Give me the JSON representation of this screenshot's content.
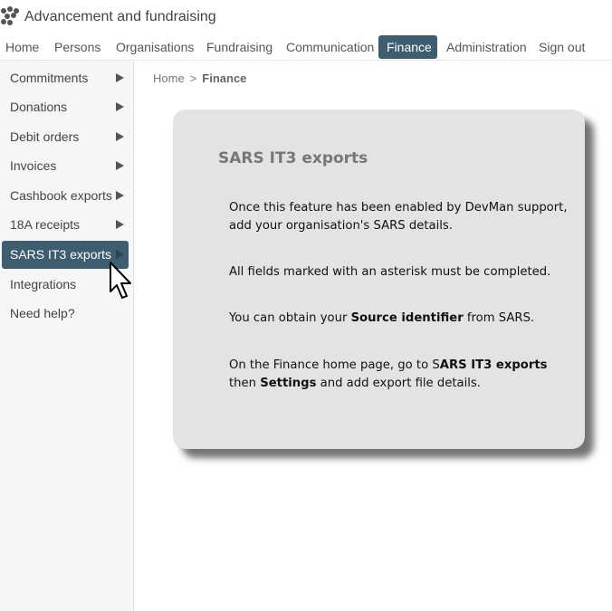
{
  "app": {
    "title": "Advancement and fundraising"
  },
  "topnav": {
    "items": [
      {
        "label": "Home"
      },
      {
        "label": "Persons"
      },
      {
        "label": "Organisations"
      },
      {
        "label": "Fundraising"
      },
      {
        "label": "Communication"
      },
      {
        "label": "Finance",
        "active": true
      },
      {
        "label": "Administration"
      },
      {
        "label": "Sign out"
      }
    ]
  },
  "sidebar": {
    "items": [
      {
        "label": "Commitments",
        "has_arrow": true
      },
      {
        "label": "Donations",
        "has_arrow": true
      },
      {
        "label": "Debit orders",
        "has_arrow": true
      },
      {
        "label": "Invoices",
        "has_arrow": true
      },
      {
        "label": "Cashbook exports",
        "has_arrow": true
      },
      {
        "label": "18A receipts",
        "has_arrow": true
      },
      {
        "label": "SARS IT3 exports",
        "has_arrow": true,
        "active": true
      },
      {
        "label": "Integrations",
        "has_arrow": false
      },
      {
        "label": "Need help?",
        "has_arrow": false
      }
    ]
  },
  "breadcrumb": {
    "home": "Home",
    "separator": ">",
    "current": "Finance"
  },
  "card": {
    "title": "SARS IT3 exports",
    "p1": "Once this feature has been enabled by DevMan support, add your organisation's SARS details.",
    "p2": "All fields marked with an asterisk must be completed.",
    "p3_before": "You can obtain your ",
    "p3_bold": "Source identifier",
    "p3_after": " from SARS.",
    "p4_a": "On the Finance home page, go to S",
    "p4_bold1": "ARS IT3 exports",
    "p4_b": " then ",
    "p4_bold2": "Settings",
    "p4_c": " and add export file details."
  },
  "colors": {
    "accent": "#3e5e70",
    "card_bg": "#e3e3e3",
    "sidebar_bg": "#f6f6f6"
  }
}
